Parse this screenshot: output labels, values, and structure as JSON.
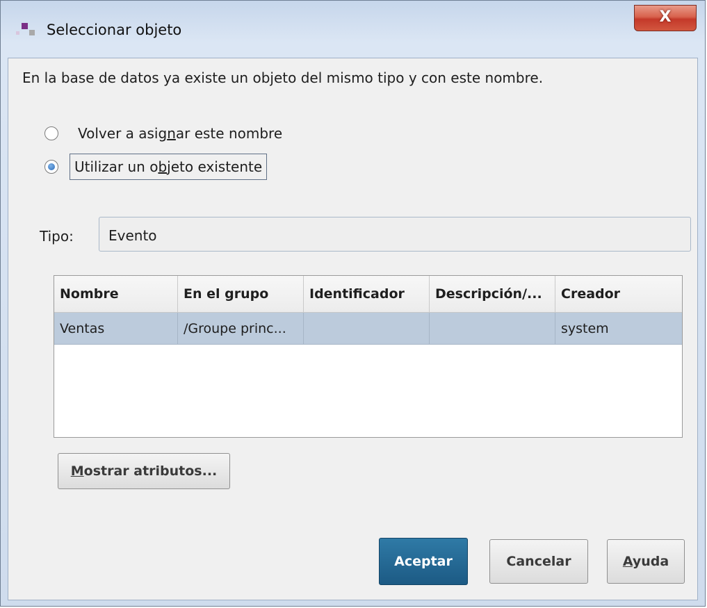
{
  "window": {
    "title": "Seleccionar objeto",
    "close_label": "X"
  },
  "message": "En la base de datos ya existe un objeto del mismo tipo y con este nombre.",
  "options": [
    {
      "pre": "Volver a asig",
      "mnemonic": "n",
      "post": "ar este nombre",
      "checked": false
    },
    {
      "pre": "Utilizar un o",
      "mnemonic": "b",
      "post": "jeto existente",
      "checked": true
    }
  ],
  "tipo": {
    "label": "Tipo:",
    "value": "Evento"
  },
  "table": {
    "columns": [
      "Nombre",
      "En el grupo",
      "Identificador",
      "Descripción/...",
      "Creador"
    ],
    "rows": [
      [
        "Ventas",
        "/Groupe princ...",
        "",
        "",
        "system"
      ]
    ]
  },
  "buttons": {
    "show_attributes": {
      "mnemonic": "M",
      "rest": "ostrar atributos..."
    },
    "accept": "Aceptar",
    "cancel": "Cancelar",
    "help": {
      "mnemonic": "A",
      "rest": "yuda"
    }
  },
  "colors": {
    "accept_bg": "#1c5a84",
    "selected_row": "#bccbdc",
    "close_button": "#c4392a"
  }
}
